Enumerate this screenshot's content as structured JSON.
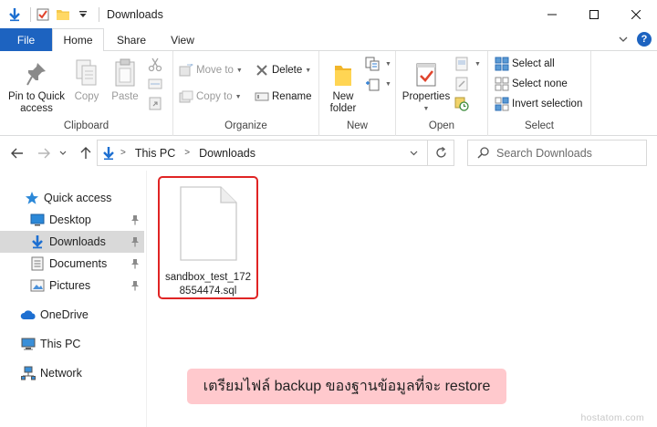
{
  "window": {
    "title": "Downloads",
    "controls": {
      "minimize": "minimize",
      "maximize": "maximize",
      "close": "close"
    }
  },
  "tabs": {
    "file": "File",
    "items": [
      {
        "label": "Home",
        "active": true
      },
      {
        "label": "Share",
        "active": false
      },
      {
        "label": "View",
        "active": false
      }
    ]
  },
  "ribbon": {
    "clipboard": {
      "label": "Clipboard",
      "pin": "Pin to Quick access",
      "pin_line1": "Pin to Quick",
      "pin_line2": "access",
      "copy": "Copy",
      "paste": "Paste"
    },
    "organize": {
      "label": "Organize",
      "move_to": "Move to",
      "copy_to": "Copy to",
      "delete": "Delete",
      "rename": "Rename"
    },
    "new": {
      "label": "New",
      "new_folder_line1": "New",
      "new_folder_line2": "folder"
    },
    "open": {
      "label": "Open",
      "properties": "Properties"
    },
    "select": {
      "label": "Select",
      "select_all": "Select all",
      "select_none": "Select none",
      "invert": "Invert selection"
    }
  },
  "address": {
    "crumbs": [
      "This PC",
      "Downloads"
    ],
    "search_placeholder": "Search Downloads"
  },
  "nav": {
    "quick_access": "Quick access",
    "desktop": "Desktop",
    "downloads": "Downloads",
    "documents": "Documents",
    "pictures": "Pictures",
    "onedrive": "OneDrive",
    "this_pc": "This PC",
    "network": "Network"
  },
  "file": {
    "name_line1": "sandbox_test_172",
    "name_line2": "8554474.sql"
  },
  "caption": "เตรียมไฟล์ backup ของฐานข้อมูลที่จะ restore",
  "watermark": "hostatom.com",
  "colors": {
    "accent": "#1d63c0",
    "highlight_border": "#e02424",
    "caption_bg": "#ffc9cd",
    "selected_nav": "#d9d9d9"
  }
}
